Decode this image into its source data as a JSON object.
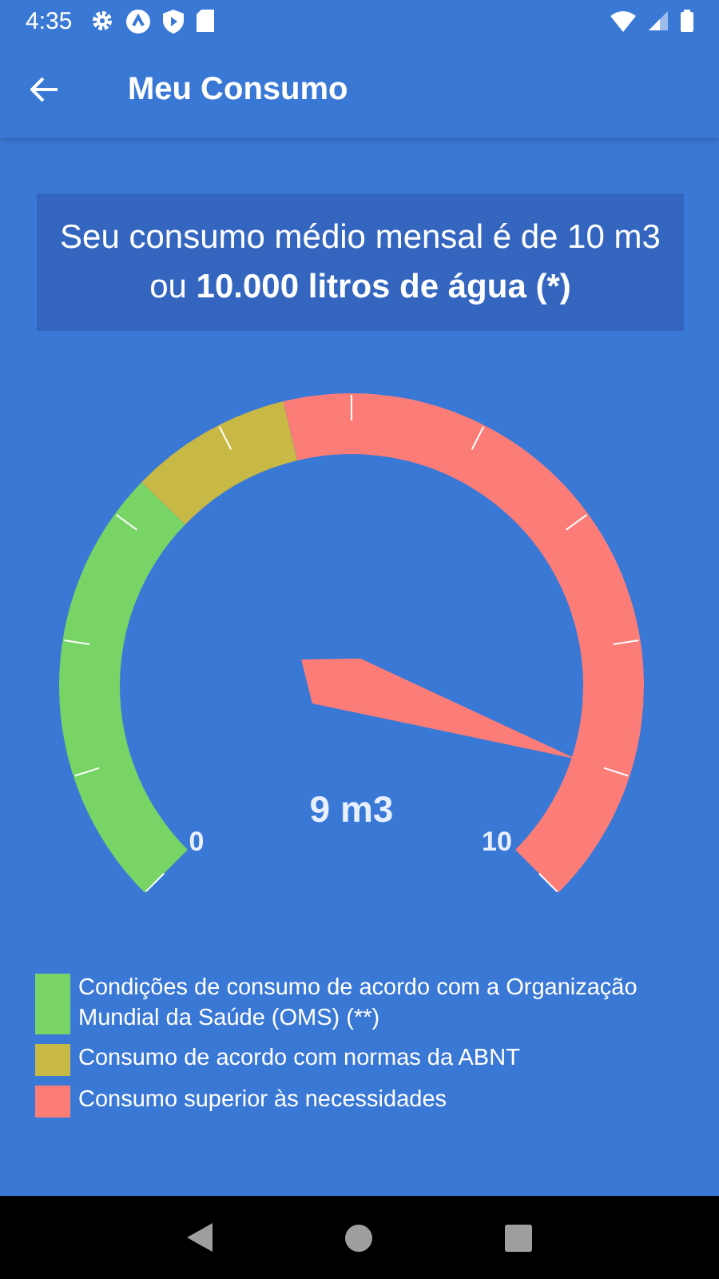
{
  "status_bar": {
    "time": "4:35"
  },
  "app_bar": {
    "title": "Meu Consumo"
  },
  "summary": "Seu consumo médio mensal é de 10 m3 ou **10.000 litros de água (*)**",
  "gauge": {
    "min_label": "0",
    "max_label": "10",
    "reading": "9 m3",
    "bands": [
      {
        "color": "#77d465"
      },
      {
        "color": "#c8b845"
      },
      {
        "color": "#fc7d78"
      }
    ]
  },
  "legend": [
    {
      "color": "#77d465",
      "label": "Condições de consumo de acordo com a Organização Mundial da Saúde (OMS) (**)"
    },
    {
      "color": "#c8b845",
      "label": "Consumo de acordo com normas da ABNT"
    },
    {
      "color": "#fc7d78",
      "label": "Consumo superior às necessidades"
    }
  ]
}
